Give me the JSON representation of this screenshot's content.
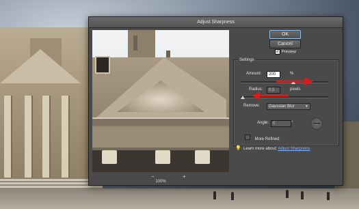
{
  "dialog": {
    "title": "Adjust Sharpness",
    "ok_label": "OK",
    "cancel_label": "Cancel",
    "preview_label": "Preview",
    "preview_checked": true,
    "zoom_level": "100%",
    "zoom_out_symbol": "−",
    "zoom_in_symbol": "+"
  },
  "settings": {
    "title": "Settings",
    "amount_label": "Amount:",
    "amount_value": "200",
    "amount_unit": "%",
    "amount_slider": 0.6,
    "radius_label": "Radius:",
    "radius_value": "0.5",
    "radius_unit": "pixels",
    "radius_slider": 0.02,
    "remove_label": "Remove:",
    "remove_value": "Gaussian Blur",
    "angle_label": "Angle:",
    "angle_value": "0",
    "angle_unit": "°",
    "more_refined_label": "More Refined",
    "more_refined_checked": false
  },
  "help": {
    "prefix": "Learn more about:",
    "link": "Adjust Sharpness",
    "icon": "lightbulb-icon"
  },
  "colors": {
    "dialog_bg": "#4a4a4a",
    "link": "#7fb6ff",
    "annotation_arrow": "#e0191b"
  }
}
